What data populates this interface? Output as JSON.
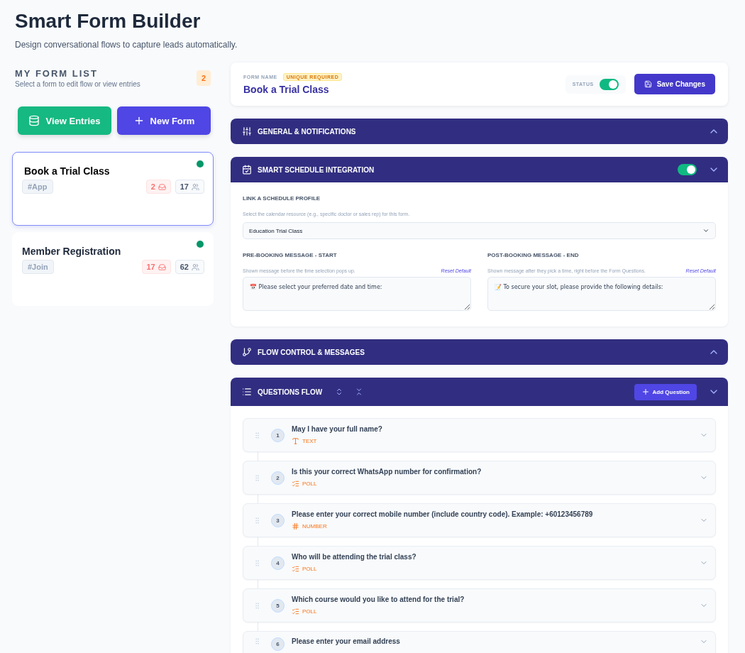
{
  "page": {
    "title": "Smart Form Builder",
    "subtitle": "Design conversational flows to capture leads automatically."
  },
  "sidebar": {
    "title": "MY FORM LIST",
    "subtitle": "Select a form to edit flow or view entries",
    "count": "2",
    "buttons": [
      {
        "label": "View Entries",
        "kind": "entries"
      },
      {
        "label": "New Form",
        "kind": "new"
      }
    ],
    "forms": [
      {
        "name": "Book a Trial Class",
        "tag": "#App",
        "inbox": "2",
        "users": "17",
        "selected": true,
        "active": true
      },
      {
        "name": "Member Registration",
        "tag": "#Join",
        "inbox": "17",
        "users": "62",
        "selected": false,
        "active": true
      }
    ]
  },
  "editor": {
    "form_name_label": "FORM NAME",
    "badge": "UNIQUE REQUIRED",
    "form_name": "Book a Trial Class",
    "status_label": "STATUS",
    "status_on": true,
    "save_button": "Save Changes"
  },
  "sections": [
    {
      "kind": "general",
      "title": "GENERAL & NOTIFICATIONS",
      "expanded": false
    },
    {
      "kind": "schedule",
      "title": "SMART SCHEDULE INTEGRATION",
      "expanded": true,
      "on": true,
      "profile_label": "LINK A SCHEDULE PROFILE",
      "profile_hint": "Select the calendar resource (e.g., specific doctor or sales rep) for this form.",
      "profile_value": "Education Trial Class",
      "messages": [
        {
          "label": "PRE-BOOKING MESSAGE - START",
          "hint": "Shown message before the time selection pops up.",
          "reset": "Reset Default",
          "value": "📅 Please select your preferred date and time:"
        },
        {
          "label": "POST-BOOKING MESSAGE - END",
          "hint": "Shown message after they pick a time, right before the Form Questions.",
          "reset": "Reset Default",
          "value": "📝 To secure your slot, please provide the following details:"
        }
      ]
    },
    {
      "kind": "flow",
      "title": "FLOW CONTROL & MESSAGES",
      "expanded": false
    },
    {
      "kind": "questions",
      "title": "QUESTIONS FLOW",
      "expanded": true,
      "add_button": "Add Question",
      "questions": [
        {
          "number": "1",
          "text": "May I have your full name?",
          "kind": "text",
          "type": "TEXT"
        },
        {
          "number": "2",
          "text": "Is this your correct WhatsApp number for confirmation?",
          "kind": "poll",
          "type": "POLL"
        },
        {
          "number": "3",
          "text": "Please enter your correct mobile number (include country code). Example: +60123456789",
          "kind": "number",
          "type": "NUMBER"
        },
        {
          "number": "4",
          "text": "Who will be attending the trial class?",
          "kind": "poll",
          "type": "POLL"
        },
        {
          "number": "5",
          "text": "Which course would you like to attend for the trial?",
          "kind": "poll",
          "type": "POLL"
        },
        {
          "number": "6",
          "text": "Please enter your email address"
        }
      ]
    }
  ]
}
